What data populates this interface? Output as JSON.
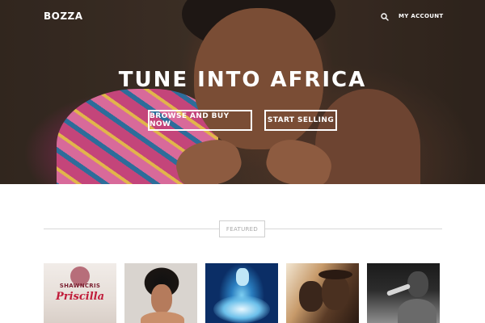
{
  "nav": {
    "logo": "BOZZA",
    "search_icon": "search-icon",
    "account_label": "MY ACCOUNT"
  },
  "hero": {
    "headline": "TUNE INTO AFRICA",
    "buttons": {
      "browse": "BROWSE AND BUY NOW",
      "sell": "START SELLING"
    }
  },
  "featured": {
    "label": "FEATURED",
    "items": [
      {
        "title": "SHAWNCRIS",
        "subtitle": "Priscilla"
      },
      {
        "title": ""
      },
      {
        "title": ""
      },
      {
        "title": ""
      },
      {
        "title": ""
      }
    ]
  },
  "colors": {
    "hero_overlay": "#3f3127",
    "accent_text": "#ffffff",
    "divider": "#d8d8d8"
  }
}
